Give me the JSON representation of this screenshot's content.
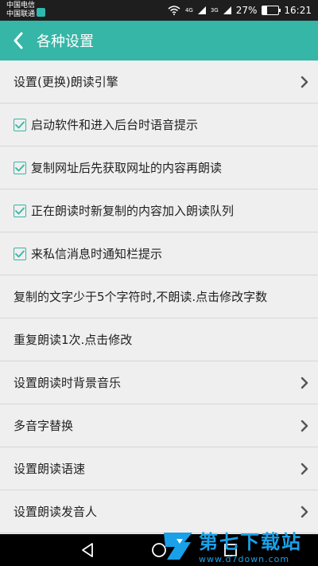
{
  "status_bar": {
    "carrier_1": "中国电信",
    "carrier_2": "中国联通",
    "net_1": "4G",
    "net_2": "3G",
    "battery": "27%",
    "battery_level": 0.27,
    "time": "16:21"
  },
  "app_bar": {
    "title": "各种设置"
  },
  "settings": {
    "items": [
      {
        "label": "设置(更换)朗读引擎",
        "checked": false,
        "chevron": true
      },
      {
        "label": "启动软件和进入后台时语音提示",
        "checked": true,
        "chevron": false
      },
      {
        "label": "复制网址后先获取网址的内容再朗读",
        "checked": true,
        "chevron": false
      },
      {
        "label": "正在朗读时新复制的内容加入朗读队列",
        "checked": true,
        "chevron": false
      },
      {
        "label": "来私信消息时通知栏提示",
        "checked": true,
        "chevron": false
      },
      {
        "label": "复制的文字少于5个字符时,不朗读.点击修改字数",
        "checked": false,
        "chevron": false
      },
      {
        "label": "重复朗读1次.点击修改",
        "checked": false,
        "chevron": false
      },
      {
        "label": "设置朗读时背景音乐",
        "checked": false,
        "chevron": true
      },
      {
        "label": "多音字替换",
        "checked": false,
        "chevron": true
      },
      {
        "label": "设置朗读语速",
        "checked": false,
        "chevron": true
      },
      {
        "label": "设置朗读发音人",
        "checked": false,
        "chevron": true
      }
    ]
  },
  "watermark": {
    "title": "第七下载站",
    "url": "www.d7down.com"
  },
  "colors": {
    "accent": "#35b6a6",
    "background": "#efefef",
    "divider": "#d6d6d6"
  }
}
